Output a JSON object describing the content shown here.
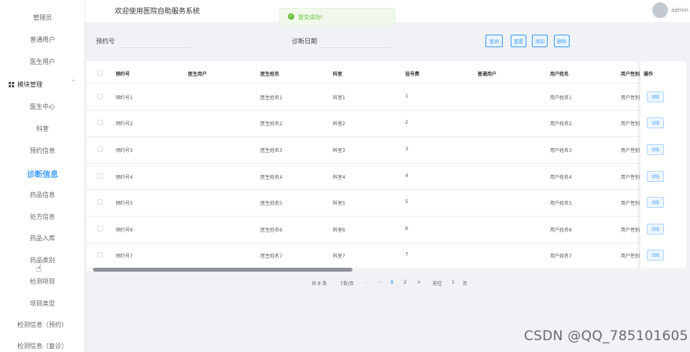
{
  "header": {
    "title": "欢迎使用医院自助服务系统",
    "user": "admin"
  },
  "toast": {
    "message": "提交成功!"
  },
  "sidebar": {
    "items_top": [
      "管理员",
      "普通用户",
      "医生用户"
    ],
    "group_label": "模块管理",
    "items": [
      "医生中心",
      "科室",
      "预约信息",
      "诊断信息",
      "药品信息",
      "处方信息",
      "药品入库",
      "药品类别",
      "检测项目",
      "项目类型",
      "检测信息（预约）",
      "检测信息（复诊）"
    ],
    "active": "诊断信息"
  },
  "search": {
    "field1_label": "预约号",
    "field1_value": "",
    "field2_label": "诊断日期",
    "field2_value": ""
  },
  "toolbar": {
    "query_label": "查询",
    "reset_label": "重置",
    "add_label": "添加",
    "delete_label": "删除"
  },
  "table": {
    "columns": [
      "预约号",
      "医生用户",
      "医生姓名",
      "科室",
      "挂号费",
      "普通用户",
      "用户姓名",
      "用户性别",
      "操作"
    ],
    "rows": [
      {
        "appt": "预约号1",
        "doctor_user": "",
        "doctor_name": "医生姓名1",
        "dept": "科室1",
        "fee": "1",
        "user": "",
        "user_name": "用户姓名1",
        "gender": "用户性别",
        "action": "详情"
      },
      {
        "appt": "预约号2",
        "doctor_user": "",
        "doctor_name": "医生姓名2",
        "dept": "科室2",
        "fee": "2",
        "user": "",
        "user_name": "用户姓名2",
        "gender": "用户性别",
        "action": "详情"
      },
      {
        "appt": "预约号3",
        "doctor_user": "",
        "doctor_name": "医生姓名3",
        "dept": "科室3",
        "fee": "3",
        "user": "",
        "user_name": "用户姓名3",
        "gender": "用户性别",
        "action": "详情"
      },
      {
        "appt": "预约号4",
        "doctor_user": "",
        "doctor_name": "医生姓名4",
        "dept": "科室4",
        "fee": "4",
        "user": "",
        "user_name": "用户姓名4",
        "gender": "用户性别",
        "action": "详情"
      },
      {
        "appt": "预约号5",
        "doctor_user": "",
        "doctor_name": "医生姓名5",
        "dept": "科室5",
        "fee": "5",
        "user": "",
        "user_name": "用户姓名5",
        "gender": "用户性别",
        "action": "详情"
      },
      {
        "appt": "预约号6",
        "doctor_user": "",
        "doctor_name": "医生姓名6",
        "dept": "科室6",
        "fee": "6",
        "user": "",
        "user_name": "用户姓名6",
        "gender": "用户性别",
        "action": "详情"
      },
      {
        "appt": "预约号7",
        "doctor_user": "",
        "doctor_name": "医生姓名7",
        "dept": "科室7",
        "fee": "7",
        "user": "",
        "user_name": "用户姓名7",
        "gender": "用户性别",
        "action": "详情"
      }
    ]
  },
  "pagination": {
    "total": "共 8 条",
    "page_size": "7条/页",
    "prev": "<",
    "pages": [
      "1",
      "2"
    ],
    "current": "1",
    "next": ">",
    "goto_prefix": "前往",
    "goto_value": "1",
    "goto_suffix": "页"
  },
  "watermark": "CSDN @QQ_785101605",
  "colors": {
    "accent": "#409eff",
    "success": "#67c23a",
    "sidebar_bg": "#ffffff",
    "content_bg": "#f0f2f5"
  }
}
